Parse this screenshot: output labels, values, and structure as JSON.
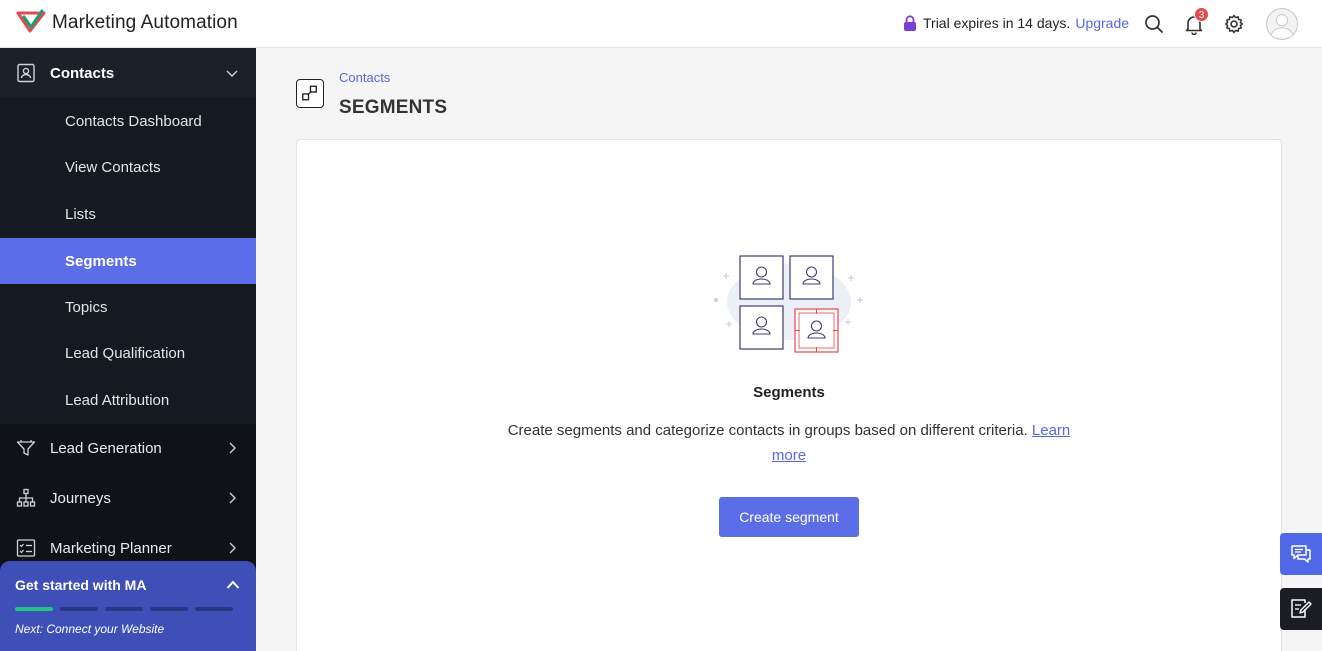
{
  "app": {
    "title": "Marketing Automation"
  },
  "header": {
    "trial_text": "Trial expires in 14 days.",
    "upgrade_label": "Upgrade",
    "notification_count": "3",
    "icons": [
      "search-icon",
      "bell-icon",
      "gear-icon",
      "avatar"
    ]
  },
  "sidebar": {
    "contacts_label": "Contacts",
    "sub_items": [
      {
        "label": "Contacts Dashboard",
        "active": false
      },
      {
        "label": "View Contacts",
        "active": false
      },
      {
        "label": "Lists",
        "active": false
      },
      {
        "label": "Segments",
        "active": true
      },
      {
        "label": "Topics",
        "active": false
      },
      {
        "label": "Lead Qualification",
        "active": false
      },
      {
        "label": "Lead Attribution",
        "active": false
      }
    ],
    "sections": [
      {
        "label": "Lead Generation",
        "icon": "funnel-icon"
      },
      {
        "label": "Journeys",
        "icon": "hierarchy-icon"
      },
      {
        "label": "Marketing Planner",
        "icon": "checklist-icon"
      }
    ],
    "get_started": {
      "title": "Get started with MA",
      "next": "Next: Connect your Website",
      "steps_total": 5,
      "steps_done": 1
    }
  },
  "main": {
    "breadcrumb": "Contacts",
    "page_title": "SEGMENTS",
    "empty_state": {
      "title": "Segments",
      "description": "Create segments and categorize contacts in groups based on different criteria.",
      "learn_more": "Learn more",
      "button_label": "Create segment"
    }
  },
  "colors": {
    "accent": "#5b6ee8",
    "link": "#5868e0",
    "sidebar_bg": "#0f1318",
    "active_item": "#5b6ee8",
    "badge": "#e5484d",
    "progress_done": "#23c483"
  }
}
